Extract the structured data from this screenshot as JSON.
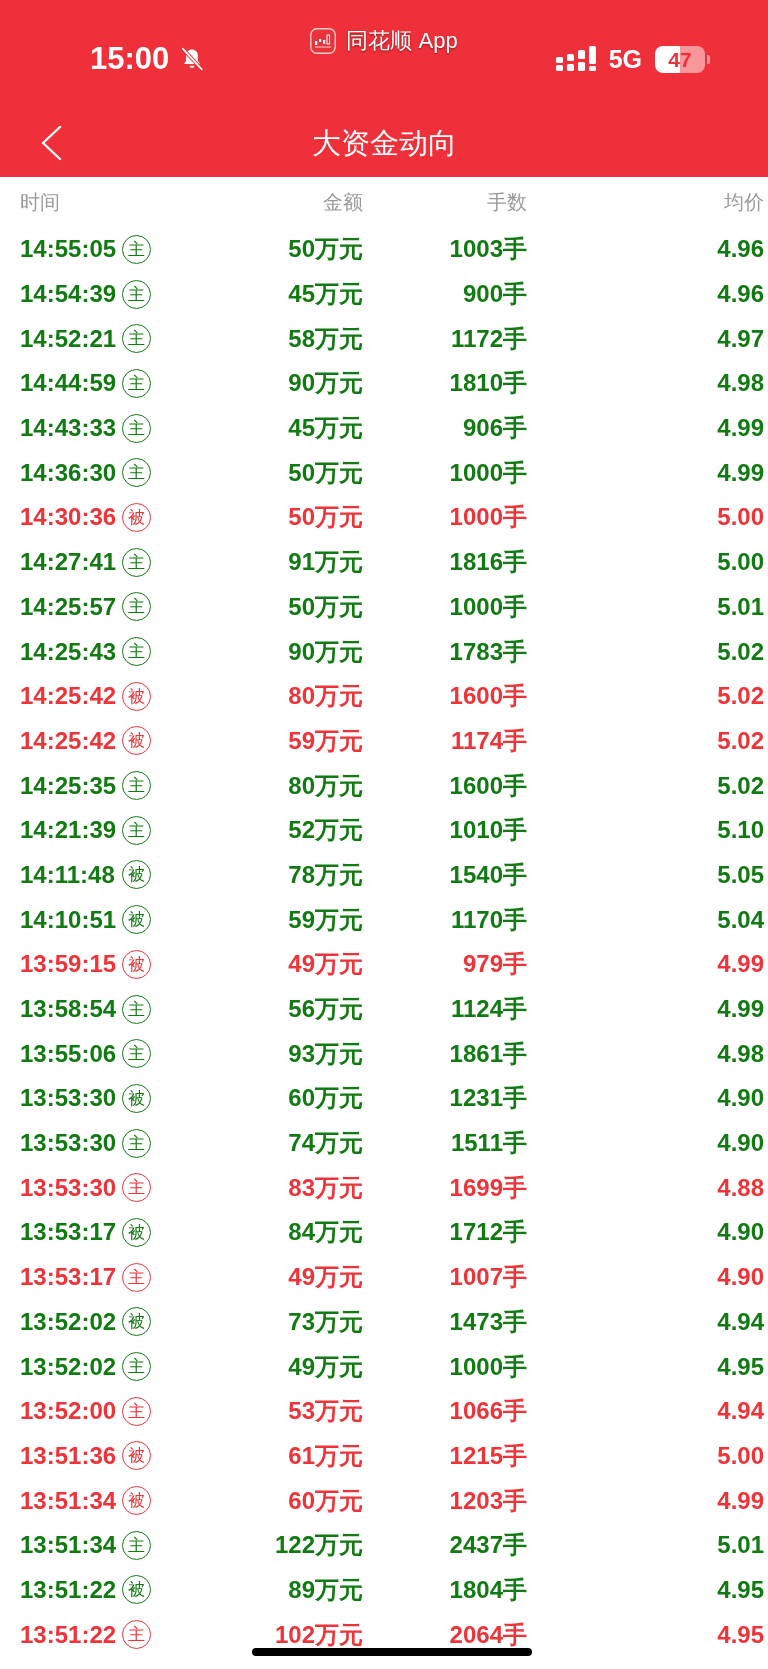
{
  "status_bar": {
    "time": "15:00",
    "app_label": "同花顺 App",
    "network": "5G",
    "battery": "47"
  },
  "header": {
    "title": "大资金动向"
  },
  "table": {
    "columns": [
      "时间",
      "金额",
      "手数",
      "均价"
    ],
    "rows": [
      {
        "time": "14:55:05",
        "type": "主",
        "amount": "50万元",
        "volume": "1003手",
        "price": "4.96",
        "color": "#127a12"
      },
      {
        "time": "14:54:39",
        "type": "主",
        "amount": "45万元",
        "volume": "900手",
        "price": "4.96",
        "color": "#127a12"
      },
      {
        "time": "14:52:21",
        "type": "主",
        "amount": "58万元",
        "volume": "1172手",
        "price": "4.97",
        "color": "#127a12"
      },
      {
        "time": "14:44:59",
        "type": "主",
        "amount": "90万元",
        "volume": "1810手",
        "price": "4.98",
        "color": "#127a12"
      },
      {
        "time": "14:43:33",
        "type": "主",
        "amount": "45万元",
        "volume": "906手",
        "price": "4.99",
        "color": "#127a12"
      },
      {
        "time": "14:36:30",
        "type": "主",
        "amount": "50万元",
        "volume": "1000手",
        "price": "4.99",
        "color": "#127a12"
      },
      {
        "time": "14:30:36",
        "type": "被",
        "amount": "50万元",
        "volume": "1000手",
        "price": "5.00",
        "color": "#ee3339"
      },
      {
        "time": "14:27:41",
        "type": "主",
        "amount": "91万元",
        "volume": "1816手",
        "price": "5.00",
        "color": "#127a12"
      },
      {
        "time": "14:25:57",
        "type": "主",
        "amount": "50万元",
        "volume": "1000手",
        "price": "5.01",
        "color": "#127a12"
      },
      {
        "time": "14:25:43",
        "type": "主",
        "amount": "90万元",
        "volume": "1783手",
        "price": "5.02",
        "color": "#127a12"
      },
      {
        "time": "14:25:42",
        "type": "被",
        "amount": "80万元",
        "volume": "1600手",
        "price": "5.02",
        "color": "#ee3339"
      },
      {
        "time": "14:25:42",
        "type": "被",
        "amount": "59万元",
        "volume": "1174手",
        "price": "5.02",
        "color": "#ee3339"
      },
      {
        "time": "14:25:35",
        "type": "主",
        "amount": "80万元",
        "volume": "1600手",
        "price": "5.02",
        "color": "#127a12"
      },
      {
        "time": "14:21:39",
        "type": "主",
        "amount": "52万元",
        "volume": "1010手",
        "price": "5.10",
        "color": "#127a12"
      },
      {
        "time": "14:11:48",
        "type": "被",
        "amount": "78万元",
        "volume": "1540手",
        "price": "5.05",
        "color": "#127a12"
      },
      {
        "time": "14:10:51",
        "type": "被",
        "amount": "59万元",
        "volume": "1170手",
        "price": "5.04",
        "color": "#127a12"
      },
      {
        "time": "13:59:15",
        "type": "被",
        "amount": "49万元",
        "volume": "979手",
        "price": "4.99",
        "color": "#ee3339"
      },
      {
        "time": "13:58:54",
        "type": "主",
        "amount": "56万元",
        "volume": "1124手",
        "price": "4.99",
        "color": "#127a12"
      },
      {
        "time": "13:55:06",
        "type": "主",
        "amount": "93万元",
        "volume": "1861手",
        "price": "4.98",
        "color": "#127a12"
      },
      {
        "time": "13:53:30",
        "type": "被",
        "amount": "60万元",
        "volume": "1231手",
        "price": "4.90",
        "color": "#127a12"
      },
      {
        "time": "13:53:30",
        "type": "主",
        "amount": "74万元",
        "volume": "1511手",
        "price": "4.90",
        "color": "#127a12"
      },
      {
        "time": "13:53:30",
        "type": "主",
        "amount": "83万元",
        "volume": "1699手",
        "price": "4.88",
        "color": "#ee3339"
      },
      {
        "time": "13:53:17",
        "type": "被",
        "amount": "84万元",
        "volume": "1712手",
        "price": "4.90",
        "color": "#127a12"
      },
      {
        "time": "13:53:17",
        "type": "主",
        "amount": "49万元",
        "volume": "1007手",
        "price": "4.90",
        "color": "#ee3339"
      },
      {
        "time": "13:52:02",
        "type": "被",
        "amount": "73万元",
        "volume": "1473手",
        "price": "4.94",
        "color": "#127a12"
      },
      {
        "time": "13:52:02",
        "type": "主",
        "amount": "49万元",
        "volume": "1000手",
        "price": "4.95",
        "color": "#127a12"
      },
      {
        "time": "13:52:00",
        "type": "主",
        "amount": "53万元",
        "volume": "1066手",
        "price": "4.94",
        "color": "#ee3339"
      },
      {
        "time": "13:51:36",
        "type": "被",
        "amount": "61万元",
        "volume": "1215手",
        "price": "5.00",
        "color": "#ee3339"
      },
      {
        "time": "13:51:34",
        "type": "被",
        "amount": "60万元",
        "volume": "1203手",
        "price": "4.99",
        "color": "#ee3339"
      },
      {
        "time": "13:51:34",
        "type": "主",
        "amount": "122万元",
        "volume": "2437手",
        "price": "5.01",
        "color": "#127a12"
      },
      {
        "time": "13:51:22",
        "type": "被",
        "amount": "89万元",
        "volume": "1804手",
        "price": "4.95",
        "color": "#127a12"
      },
      {
        "time": "13:51:22",
        "type": "主",
        "amount": "102万元",
        "volume": "2064手",
        "price": "4.95",
        "color": "#ee3339"
      }
    ]
  }
}
